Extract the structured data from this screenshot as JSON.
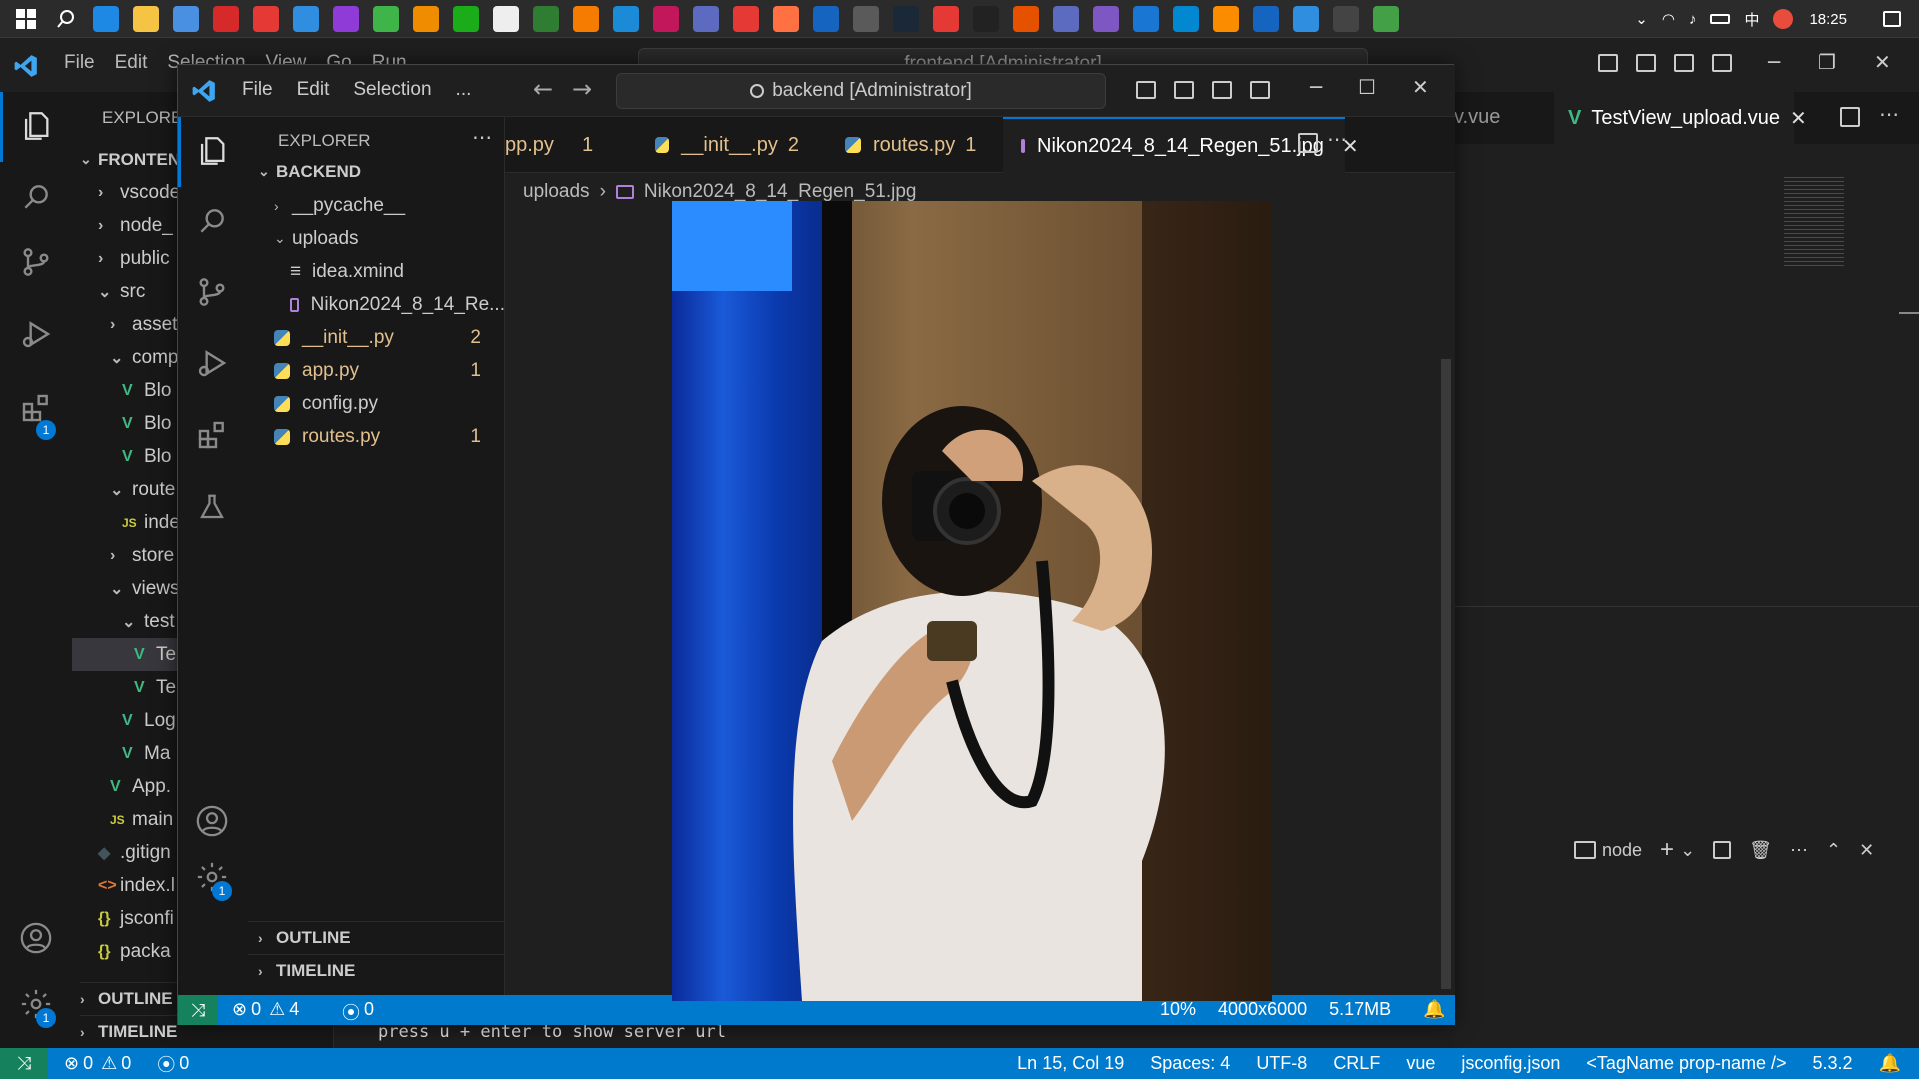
{
  "taskbar": {
    "time": "18:25",
    "ime": "中",
    "apps": [
      "windows-icon",
      "search-icon",
      "edge-icon",
      "explorer-icon",
      "app-icon",
      "wps-icon",
      "xmind-icon",
      "vscode-icon",
      "app-icon",
      "app-icon",
      "app-icon",
      "wechat-icon",
      "file-icon",
      "app-icon",
      "app-icon",
      "app-icon",
      "app-icon",
      "app-icon",
      "app-icon",
      "app-icon",
      "app-icon",
      "app-icon",
      "steam-icon",
      "app-icon",
      "typora-icon",
      "app-icon",
      "app-icon",
      "app-icon",
      "app-icon",
      "app-icon",
      "app-icon",
      "app-icon",
      "vscode-icon",
      "terminal-icon",
      "app-icon"
    ]
  },
  "bg_window": {
    "menu": [
      "File",
      "Edit",
      "Selection",
      "View",
      "Go",
      "Run",
      "..."
    ],
    "search": "frontend [Administrator]",
    "explorer_label": "EXPLORER",
    "root": "FRONTEND",
    "tree": [
      {
        "label": "vscode",
        "indent": 1,
        "kind": "folder"
      },
      {
        "label": "node_",
        "indent": 1,
        "kind": "folder"
      },
      {
        "label": "public",
        "indent": 1,
        "kind": "folder"
      },
      {
        "label": "src",
        "indent": 1,
        "kind": "folder-open"
      },
      {
        "label": "asset",
        "indent": 2,
        "kind": "folder"
      },
      {
        "label": "comp",
        "indent": 2,
        "kind": "folder-open"
      },
      {
        "label": "Blo",
        "indent": 3,
        "kind": "vue"
      },
      {
        "label": "Blo",
        "indent": 3,
        "kind": "vue"
      },
      {
        "label": "Blo",
        "indent": 3,
        "kind": "vue"
      },
      {
        "label": "route",
        "indent": 2,
        "kind": "folder-open"
      },
      {
        "label": "inde",
        "indent": 3,
        "kind": "js"
      },
      {
        "label": "store",
        "indent": 2,
        "kind": "folder"
      },
      {
        "label": "views",
        "indent": 2,
        "kind": "folder-open"
      },
      {
        "label": "test",
        "indent": 3,
        "kind": "folder-open"
      },
      {
        "label": "Te",
        "indent": 4,
        "kind": "vue"
      },
      {
        "label": "Te",
        "indent": 4,
        "kind": "vue"
      },
      {
        "label": "Log",
        "indent": 3,
        "kind": "vue"
      },
      {
        "label": "Ma",
        "indent": 3,
        "kind": "vue"
      },
      {
        "label": "App.",
        "indent": 2,
        "kind": "vue"
      },
      {
        "label": "main",
        "indent": 2,
        "kind": "js"
      },
      {
        "label": ".gitign",
        "indent": 1,
        "kind": "git"
      },
      {
        "label": "index.l",
        "indent": 1,
        "kind": "html"
      },
      {
        "label": "jsconfi",
        "indent": 1,
        "kind": "json"
      },
      {
        "label": "packa",
        "indent": 1,
        "kind": "json"
      }
    ],
    "outline": "OUTLINE",
    "timeline": "TIMELINE",
    "tab_partial": "v.vue",
    "tab_active": "TestView_upload.vue",
    "terminal_name": "node",
    "terminal_line": "press u + enter to show server url",
    "activity_badge": "1",
    "settings_badge": "1",
    "status": {
      "errors": "0",
      "warnings": "0",
      "ports": "0",
      "position": "Ln 15, Col 19",
      "spaces": "Spaces: 4",
      "encoding": "UTF-8",
      "eol": "CRLF",
      "language": "vue",
      "config": "jsconfig.json",
      "tag": "<TagName prop-name />",
      "version": "5.3.2"
    }
  },
  "fg_window": {
    "menu": [
      "File",
      "Edit",
      "Selection",
      "..."
    ],
    "search": "backend [Administrator]",
    "explorer_label": "EXPLORER",
    "root": "BACKEND",
    "tree": [
      {
        "label": "__pycache__",
        "kind": "folder",
        "badge": ""
      },
      {
        "label": "uploads",
        "kind": "folder-open",
        "badge": ""
      },
      {
        "label": "idea.xmind",
        "kind": "text",
        "badge": ""
      },
      {
        "label": "Nikon2024_8_14_Re...",
        "kind": "image",
        "badge": ""
      },
      {
        "label": "__init__.py",
        "kind": "py",
        "badge": "2"
      },
      {
        "label": "app.py",
        "kind": "py",
        "badge": "1"
      },
      {
        "label": "config.py",
        "kind": "py",
        "badge": ""
      },
      {
        "label": "routes.py",
        "kind": "py",
        "badge": "1"
      }
    ],
    "outline": "OUTLINE",
    "timeline": "TIMELINE",
    "tabs": [
      {
        "label": "pp.py",
        "badge": "1"
      },
      {
        "label": "__init__.py",
        "badge": "2"
      },
      {
        "label": "routes.py",
        "badge": "1"
      },
      {
        "label": "Nikon2024_8_14_Regen_51.jpg",
        "badge": ""
      }
    ],
    "breadcrumb": [
      "uploads",
      "Nikon2024_8_14_Regen_51.jpg"
    ],
    "settings_badge": "1",
    "status": {
      "errors": "0",
      "warnings": "4",
      "ports": "0",
      "zoom": "10%",
      "dimensions": "4000x6000",
      "size": "5.17MB"
    }
  },
  "colors": {
    "accent": "#007acc",
    "modified": "#e2c08d",
    "vue": "#41b883",
    "python_blue": "#4584b6",
    "python_yellow": "#ffde57"
  }
}
